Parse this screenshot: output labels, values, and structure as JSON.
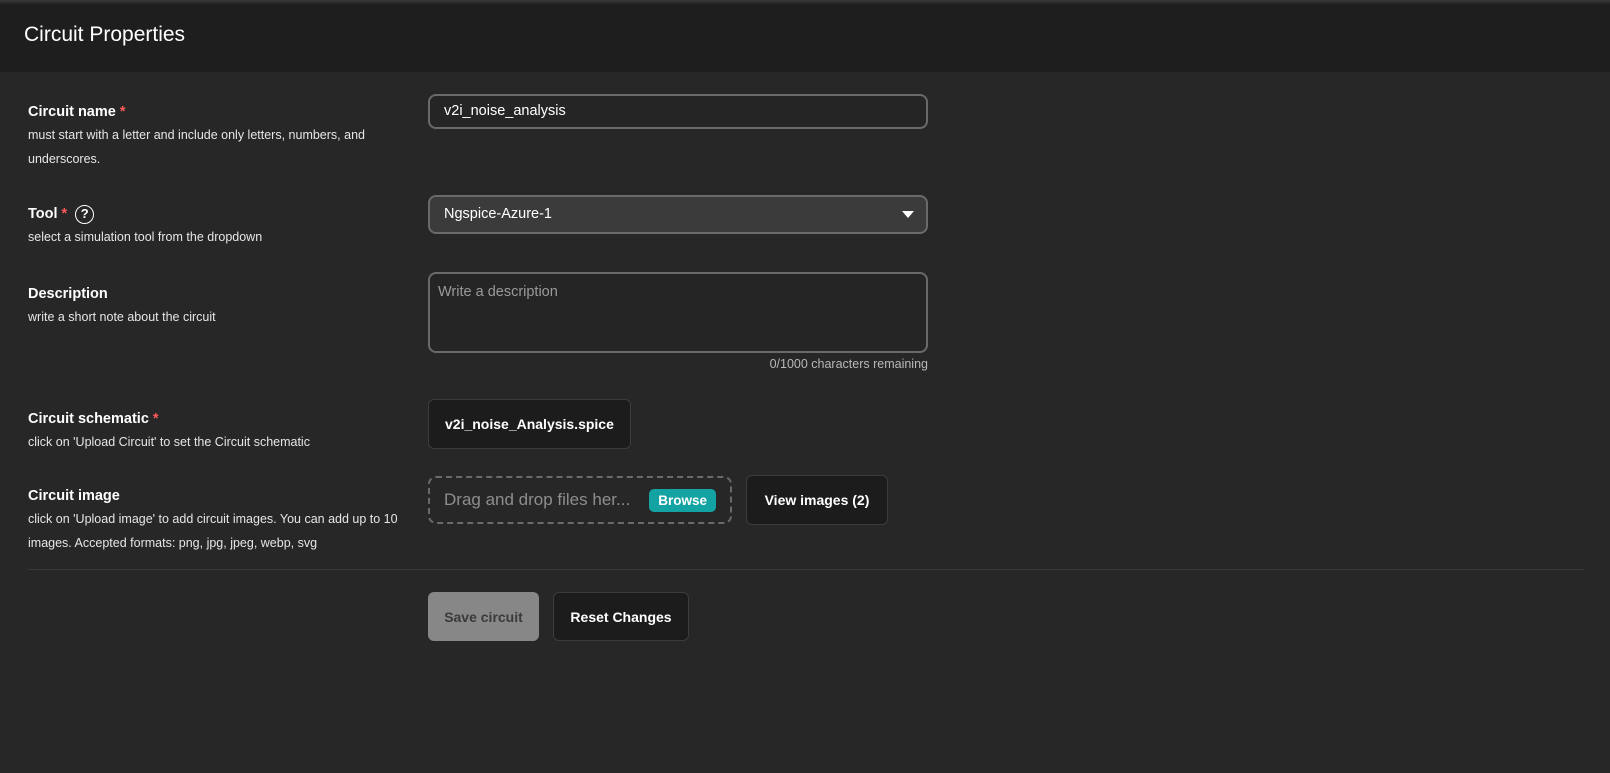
{
  "header": {
    "title": "Circuit Properties"
  },
  "fields": {
    "name": {
      "label": "Circuit name",
      "required_mark": "*",
      "hint": "must start with a letter and include only letters, numbers, and underscores.",
      "value": "v2i_noise_analysis"
    },
    "tool": {
      "label": "Tool",
      "required_mark": "*",
      "help_icon": "?",
      "hint": "select a simulation tool from the dropdown",
      "selected": "Ngspice-Azure-1"
    },
    "description": {
      "label": "Description",
      "hint": "write a short note about the circuit",
      "placeholder": "Write a description",
      "char_count": "0/1000 characters remaining"
    },
    "schematic": {
      "label": "Circuit schematic",
      "required_mark": "*",
      "hint": "click on 'Upload Circuit' to set the Circuit schematic",
      "file_name": "v2i_noise_Analysis.spice"
    },
    "image": {
      "label": "Circuit image",
      "hint": "click on 'Upload image' to add circuit images. You can add up to 10 images. Accepted formats: png, jpg, jpeg, webp, svg",
      "dropzone_text": "Drag and drop files her...",
      "browse_label": "Browse",
      "view_label": "View images (2)"
    }
  },
  "actions": {
    "save_label": "Save circuit",
    "reset_label": "Reset Changes"
  },
  "colors": {
    "background": "#272727",
    "header_bg": "#1e1e1e",
    "required": "#ff5a5a",
    "browse_accent": "#13a3a3",
    "save_disabled": "#878787"
  }
}
